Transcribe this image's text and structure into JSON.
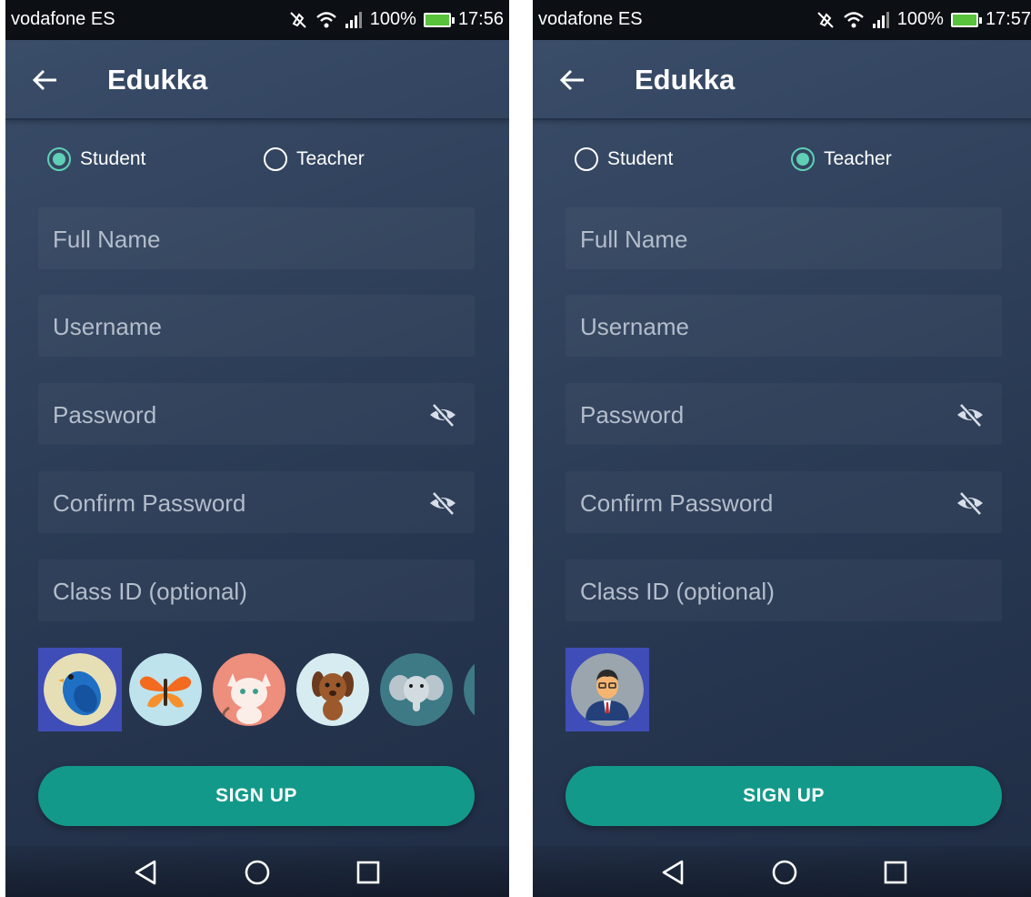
{
  "screens": [
    {
      "status": {
        "carrier": "vodafone ES",
        "battery": "100%",
        "time": "17:56"
      },
      "app_title": "Edukka",
      "roles": [
        {
          "label": "Student",
          "checked": true
        },
        {
          "label": "Teacher",
          "checked": false
        }
      ],
      "fields": {
        "full_name": "Full Name",
        "username": "Username",
        "password": "Password",
        "confirm_password": "Confirm Password",
        "class_id": "Class ID (optional)"
      },
      "avatars": [
        "bird-avatar",
        "butterfly-avatar",
        "cat-avatar",
        "dog-avatar",
        "elephant-avatar",
        "partial-avatar"
      ],
      "selected_avatar": "bird-avatar",
      "signup_label": "SIGN UP"
    },
    {
      "status": {
        "carrier": "vodafone ES",
        "battery": "100%",
        "time": "17:57"
      },
      "app_title": "Edukka",
      "roles": [
        {
          "label": "Student",
          "checked": false
        },
        {
          "label": "Teacher",
          "checked": true
        }
      ],
      "fields": {
        "full_name": "Full Name",
        "username": "Username",
        "password": "Password",
        "confirm_password": "Confirm Password",
        "class_id": "Class ID (optional)"
      },
      "avatars": [
        "teacher-avatar"
      ],
      "selected_avatar": "teacher-avatar",
      "signup_label": "SIGN UP"
    }
  ],
  "colors": {
    "accent": "#13998a",
    "radio_selected": "#5fd0b5",
    "avatar_selected_bg": "#3f4db8"
  }
}
